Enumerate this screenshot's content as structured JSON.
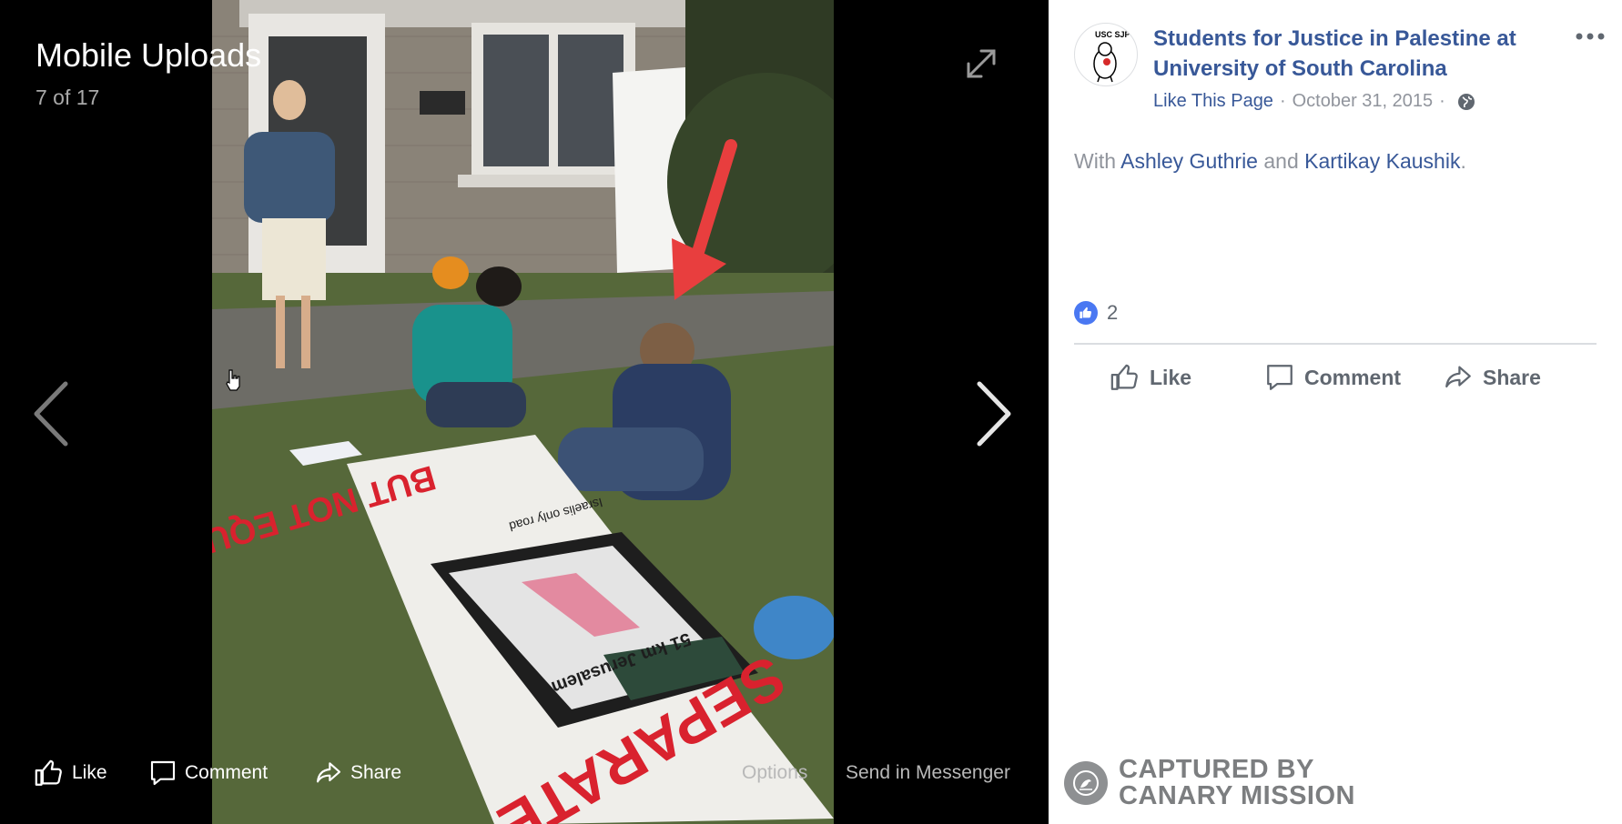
{
  "viewer": {
    "album_title": "Mobile Uploads",
    "position": "7 of 17",
    "actions": {
      "like": "Like",
      "comment": "Comment",
      "share": "Share",
      "options": "Options",
      "send": "Send in Messenger"
    },
    "photo": {
      "sign_top": "BUT NOT EQUAL",
      "sign_bottom": "SEPARATE",
      "map_label": "51 km Jerusalem",
      "sign_note": "Israelis only road"
    }
  },
  "post": {
    "avatar_text": "USC SJP",
    "page_name": "Students for Justice in Palestine at University of South Carolina",
    "like_page": "Like This Page",
    "separator": "·",
    "date": "October 31, 2015",
    "with_prefix": "With",
    "tag_1": "Ashley Guthrie",
    "and": "and",
    "tag_2": "Kartikay Kaushik",
    "period": ".",
    "reaction_count": "2",
    "actions": {
      "like": "Like",
      "comment": "Comment",
      "share": "Share"
    }
  },
  "watermark": {
    "line1": "CAPTURED BY",
    "line2": "CANARY MISSION"
  },
  "colors": {
    "link": "#385898",
    "muted": "#90949c",
    "like_blue": "#4a78f2",
    "viewer_bg": "#000000",
    "arrow_red": "#e83e3e"
  },
  "icons": [
    "expand-icon",
    "chevron-left-icon",
    "chevron-right-icon",
    "thumbs-up-icon",
    "comment-icon",
    "share-icon",
    "more-icon",
    "globe-icon",
    "pointer-cursor-icon",
    "canary-bird-icon"
  ]
}
